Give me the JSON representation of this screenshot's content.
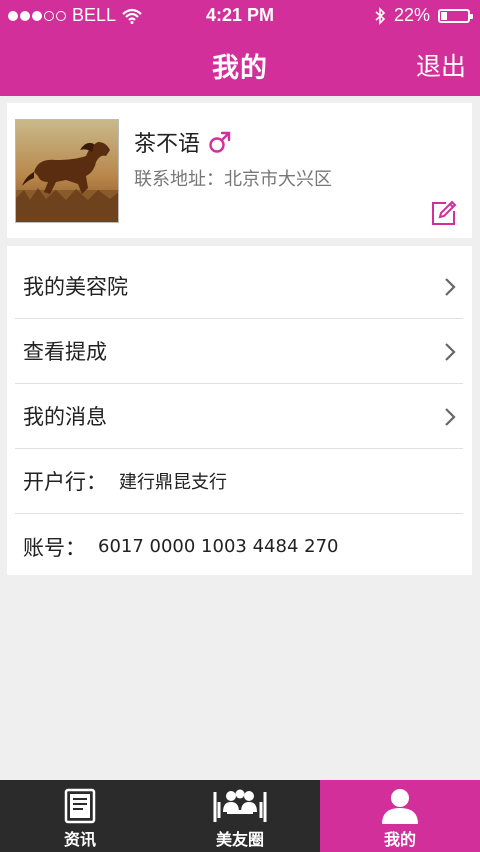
{
  "status_bar": {
    "carrier": "BELL",
    "time": "4:21 PM",
    "battery_percent": "22%",
    "battery_level": 0.22,
    "signal_bars": 3
  },
  "header": {
    "title": "我的",
    "logout_label": "退出"
  },
  "profile": {
    "name": "茶不语",
    "gender_symbol": "♂",
    "address_label": "联系地址：",
    "address_value": "北京市大兴区"
  },
  "menu": {
    "items": [
      {
        "label": "我的美容院"
      },
      {
        "label": "查看提成"
      },
      {
        "label": "我的消息"
      }
    ],
    "bank": {
      "label": "开户行：",
      "value": "建行鼎昆支行"
    },
    "account": {
      "label": "账号：",
      "value": "6017 0000 1003 4484 270"
    }
  },
  "tabbar": {
    "tabs": [
      {
        "label": "资讯",
        "icon": "news-icon"
      },
      {
        "label": "美友圈",
        "icon": "friends-icon"
      },
      {
        "label": "我的",
        "icon": "user-icon",
        "active": true
      }
    ]
  },
  "colors": {
    "brand": "#d32f9a",
    "tabbar_bg": "#2b2b2b",
    "page_bg": "#efefef"
  }
}
